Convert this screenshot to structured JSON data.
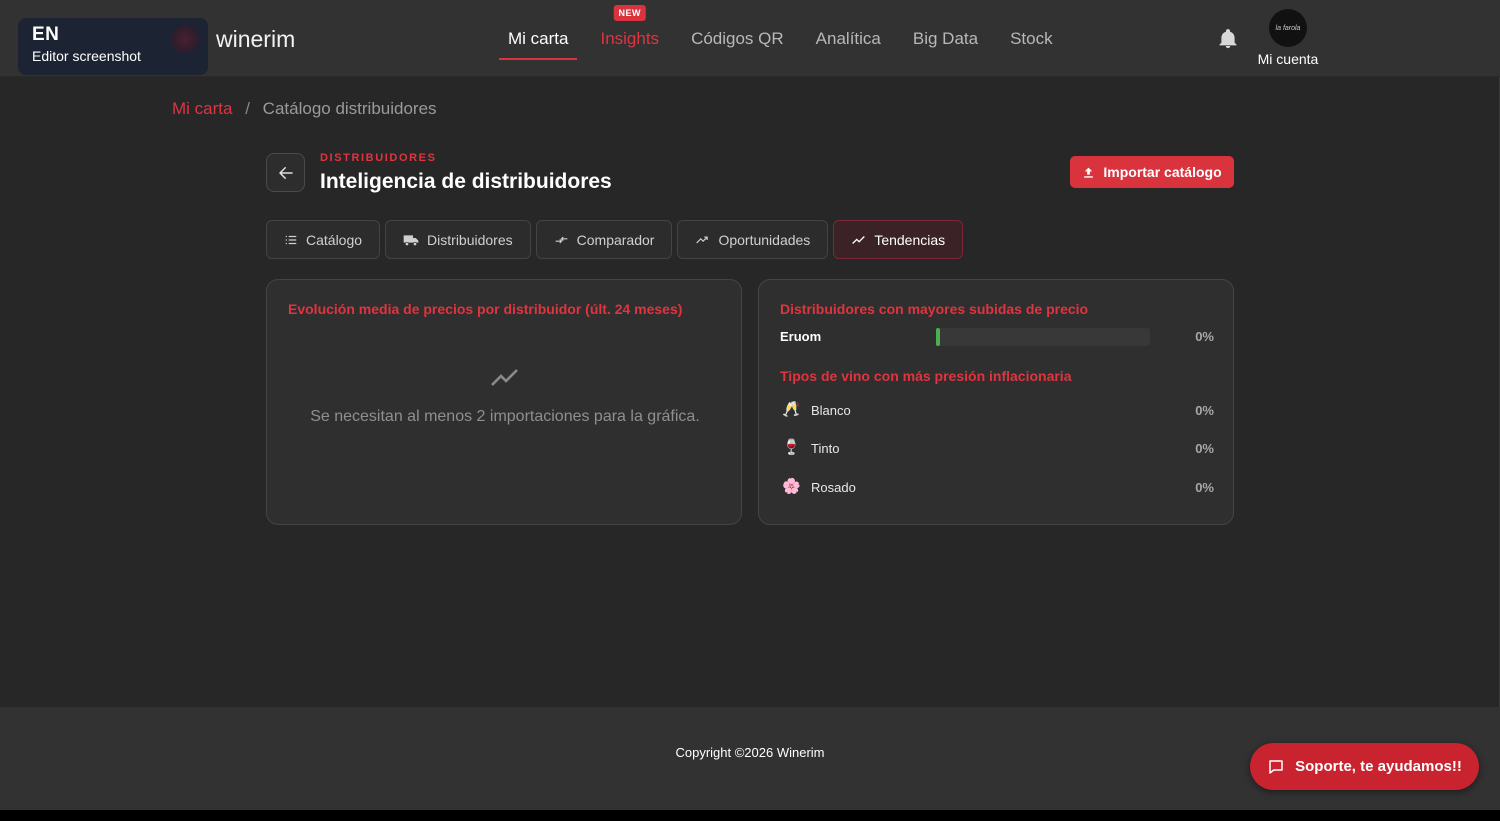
{
  "colors": {
    "accent": "#d9343e",
    "bar": "#4caf50",
    "background": "#272727"
  },
  "editor_badge": {
    "language": "EN",
    "label": "Editor screenshot"
  },
  "brand": "winerim",
  "nav": [
    {
      "label": "Mi carta",
      "state": "active"
    },
    {
      "label": "Insights",
      "state": "highlight",
      "badge": "NEW"
    },
    {
      "label": "Códigos QR",
      "state": "normal"
    },
    {
      "label": "Analítica",
      "state": "normal"
    },
    {
      "label": "Big Data",
      "state": "normal"
    },
    {
      "label": "Stock",
      "state": "normal"
    }
  ],
  "account": {
    "label": "Mi cuenta",
    "avatar_text": "la farola",
    "icon": "bell-icon"
  },
  "breadcrumb": {
    "root": "Mi carta",
    "separator": "/",
    "current": "Catálogo distribuidores"
  },
  "header": {
    "eyebrow": "DISTRIBUIDORES",
    "title": "Inteligencia de distribuidores",
    "import_button": "Importar catálogo"
  },
  "tabs": [
    {
      "label": "Catálogo",
      "icon": "list-icon"
    },
    {
      "label": "Distribuidores",
      "icon": "truck-icon"
    },
    {
      "label": "Comparador",
      "icon": "compare-arrows-icon"
    },
    {
      "label": "Oportunidades",
      "icon": "trend-up-icon"
    },
    {
      "label": "Tendencias",
      "icon": "trend-line-icon",
      "active": true
    }
  ],
  "price_evolution": {
    "title": "Evolución media de precios por distribuidor (últ. 24 meses)",
    "empty_message": "Se necesitan al menos 2 importaciones para la gráfica."
  },
  "top_increases": {
    "title": "Distribuidores con mayores subidas de precio",
    "rows": [
      {
        "name": "Eruom",
        "value": "0%",
        "fill": 0
      }
    ]
  },
  "inflation_types": {
    "title": "Tipos de vino con más presión inflacionaria",
    "rows": [
      {
        "emoji": "🥂",
        "name": "Blanco",
        "value": "0%"
      },
      {
        "emoji": "🍷",
        "name": "Tinto",
        "value": "0%"
      },
      {
        "emoji": "🌸",
        "name": "Rosado",
        "value": "0%"
      }
    ]
  },
  "footer": {
    "copyright": "Copyright ©2026 Winerim"
  },
  "support": {
    "label": "Soporte, te ayudamos!!"
  }
}
